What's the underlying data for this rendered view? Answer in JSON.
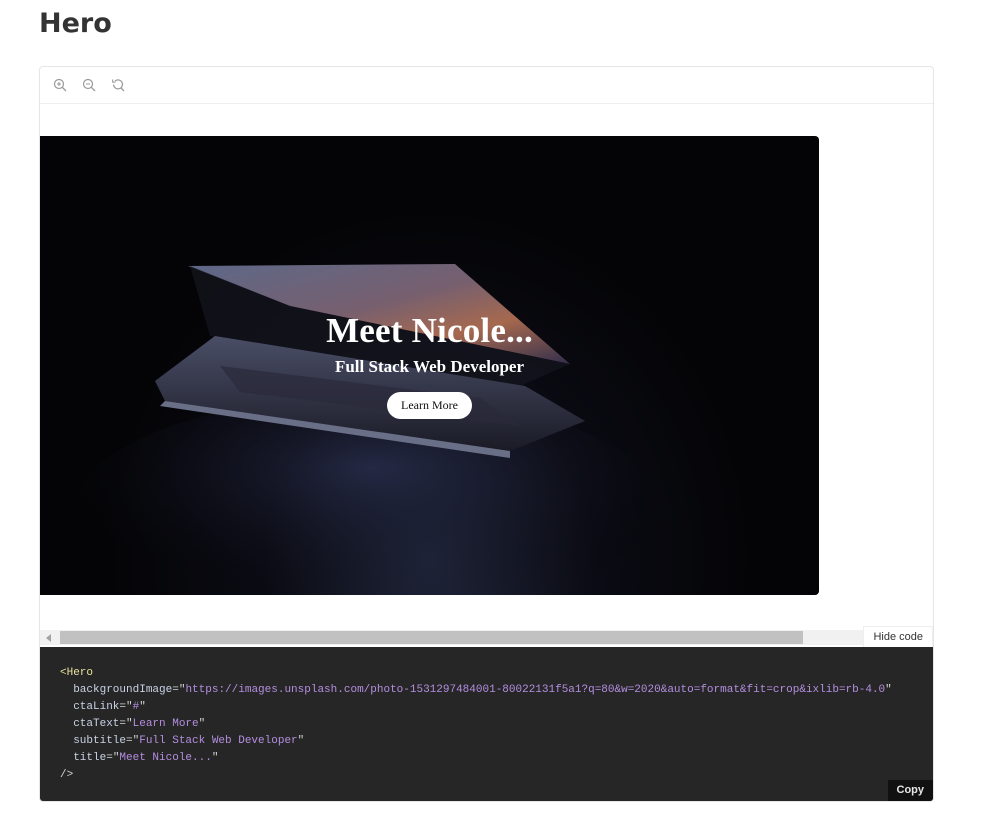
{
  "page": {
    "title": "Hero"
  },
  "toolbar": {
    "icons": [
      "zoom-in-icon",
      "zoom-out-icon",
      "reset-zoom-icon"
    ]
  },
  "hero": {
    "title": "Meet Nicole...",
    "subtitle": "Full Stack Web Developer",
    "cta_text": "Learn More"
  },
  "code": {
    "component": "Hero",
    "attrs": [
      {
        "name": "backgroundImage",
        "value": "https://images.unsplash.com/photo-1531297484001-80022131f5a1?q=80&w=2020&auto=format&fit=crop&ixlib=rb-4.0"
      },
      {
        "name": "ctaLink",
        "value": "#"
      },
      {
        "name": "ctaText",
        "value": "Learn More"
      },
      {
        "name": "subtitle",
        "value": "Full Stack Web Developer"
      },
      {
        "name": "title",
        "value": "Meet Nicole..."
      }
    ],
    "close": "/>",
    "hide_code_label": "Hide code",
    "copy_label": "Copy"
  },
  "colors": {
    "code_bg": "#262626",
    "string": "#b48ee0",
    "tag": "#e8e0a0",
    "hero_bg": "#040406"
  }
}
